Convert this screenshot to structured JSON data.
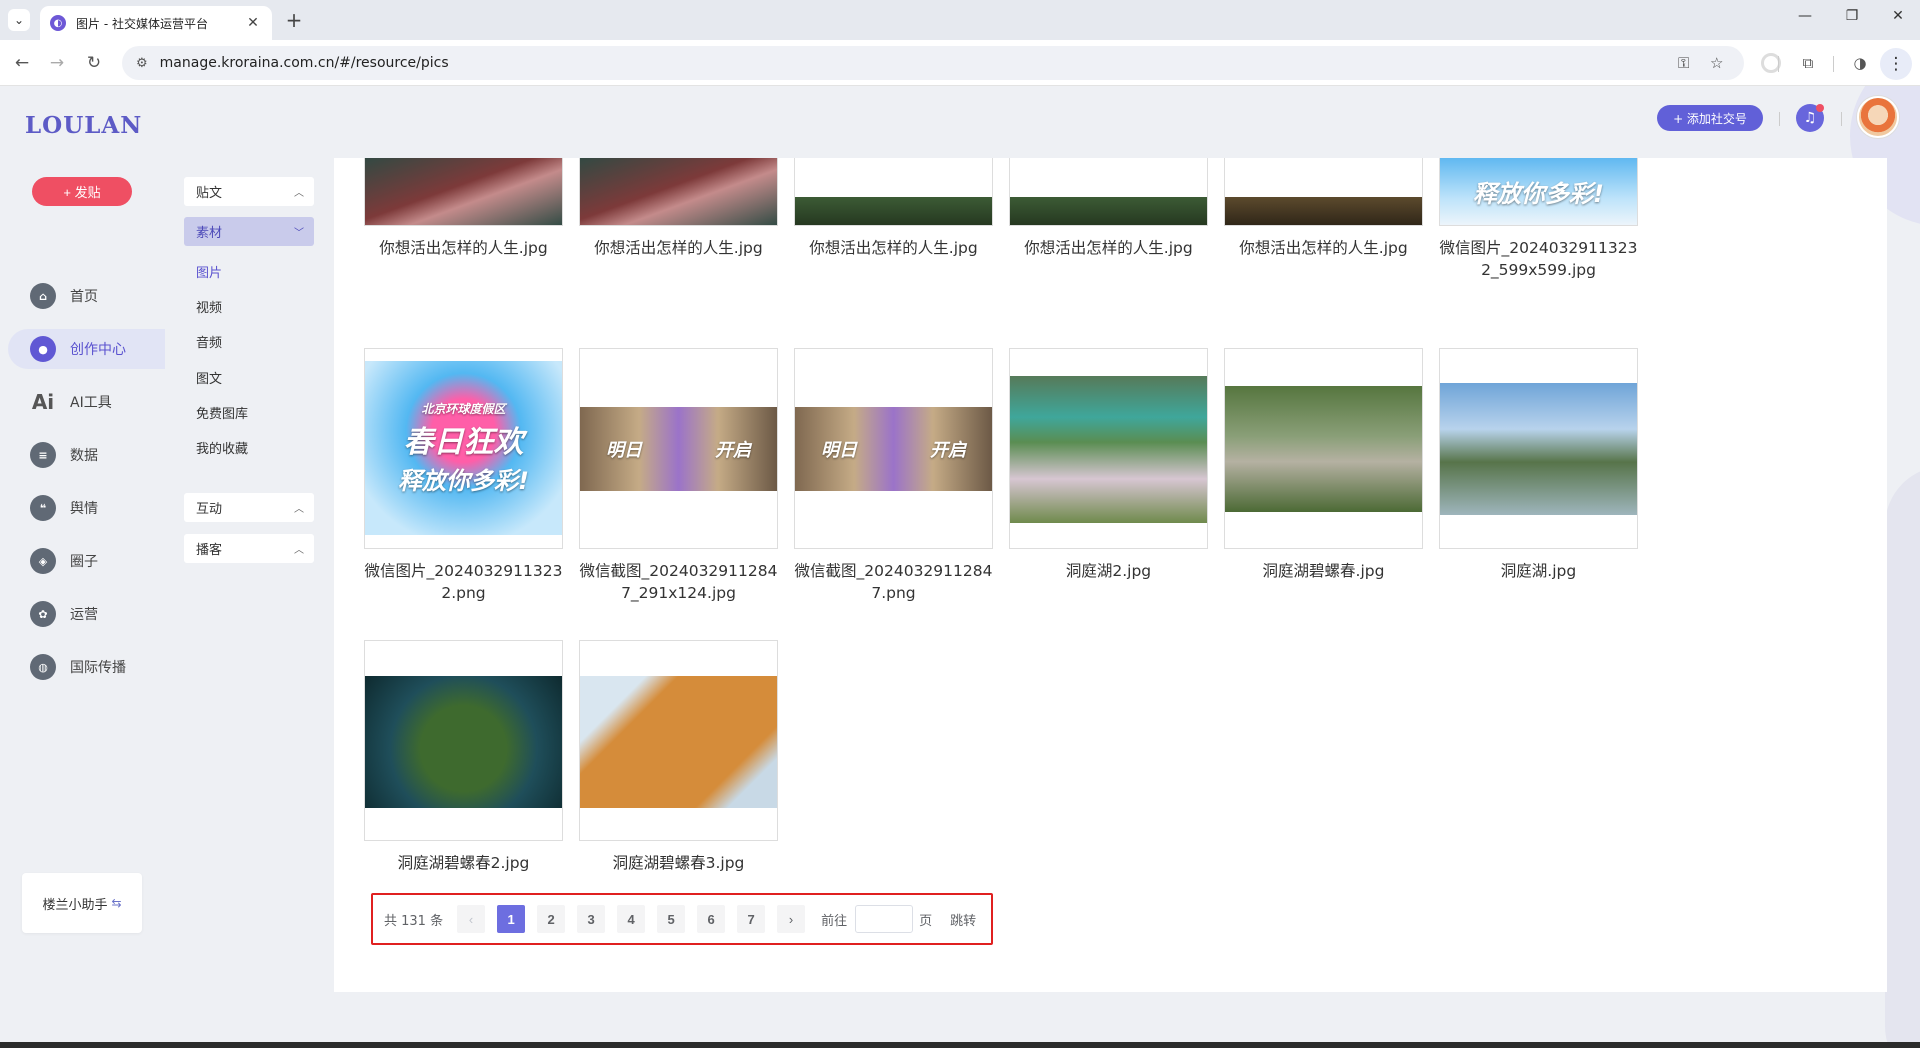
{
  "browser": {
    "tab_title": "图片 - 社交媒体运营平台",
    "url": "manage.kroraina.com.cn/#/resource/pics"
  },
  "app": {
    "logo": "LOULAN",
    "publish_label": "+ 发贴",
    "nav": [
      {
        "label": "首页",
        "icon": "home-icon"
      },
      {
        "label": "创作中心",
        "icon": "palette-icon"
      },
      {
        "label": "AI工具",
        "icon": "ai-icon"
      },
      {
        "label": "数据",
        "icon": "database-icon"
      },
      {
        "label": "舆情",
        "icon": "quote-icon"
      },
      {
        "label": "圈子",
        "icon": "compass-icon"
      },
      {
        "label": "运营",
        "icon": "cog-icon"
      },
      {
        "label": "国际传播",
        "icon": "globe-icon"
      }
    ],
    "assistant_label": "楼兰小助手",
    "add_account_label": "+ 添加社交号"
  },
  "subnav": {
    "sections": [
      "贴文",
      "素材",
      "互动",
      "播客"
    ],
    "items": [
      "图片",
      "视频",
      "音频",
      "图文",
      "免费图库",
      "我的收藏"
    ]
  },
  "gallery": [
    {
      "name": "你想活出怎样的人生.jpg",
      "scene": "poster"
    },
    {
      "name": "你想活出怎样的人生.jpg",
      "scene": "poster"
    },
    {
      "name": "你想活出怎样的人生.jpg",
      "scene": "green-dark"
    },
    {
      "name": "你想活出怎样的人生.jpg",
      "scene": "green-dark"
    },
    {
      "name": "你想活出怎样的人生.jpg",
      "scene": "brown-dark"
    },
    {
      "name": "微信图片_20240329113232_599x599.jpg",
      "scene": "festival-crop"
    },
    {
      "name": "微信图片_20240329113232.png",
      "scene": "festival"
    },
    {
      "name": "微信截图_20240329112847_291x124.jpg",
      "scene": "parade"
    },
    {
      "name": "微信截图_20240329112847.png",
      "scene": "parade"
    },
    {
      "name": "洞庭湖2.jpg",
      "scene": "lake-blossom"
    },
    {
      "name": "洞庭湖碧螺春.jpg",
      "scene": "village"
    },
    {
      "name": "洞庭湖.jpg",
      "scene": "coast"
    },
    {
      "name": "洞庭湖碧螺春2.jpg",
      "scene": "tea-hands"
    },
    {
      "name": "洞庭湖碧螺春3.jpg",
      "scene": "tea-table"
    }
  ],
  "pager": {
    "total": "共 131 条",
    "pages": [
      "1",
      "2",
      "3",
      "4",
      "5",
      "6",
      "7"
    ],
    "current": "1",
    "goto_label": "前往",
    "page_unit": "页",
    "jump_label": "跳转"
  },
  "festival_text": {
    "line1": "北京环球度假区",
    "line2": "春日狂欢",
    "line3": "释放你多彩!"
  },
  "parade_text": {
    "left": "明日",
    "right": "开启"
  }
}
